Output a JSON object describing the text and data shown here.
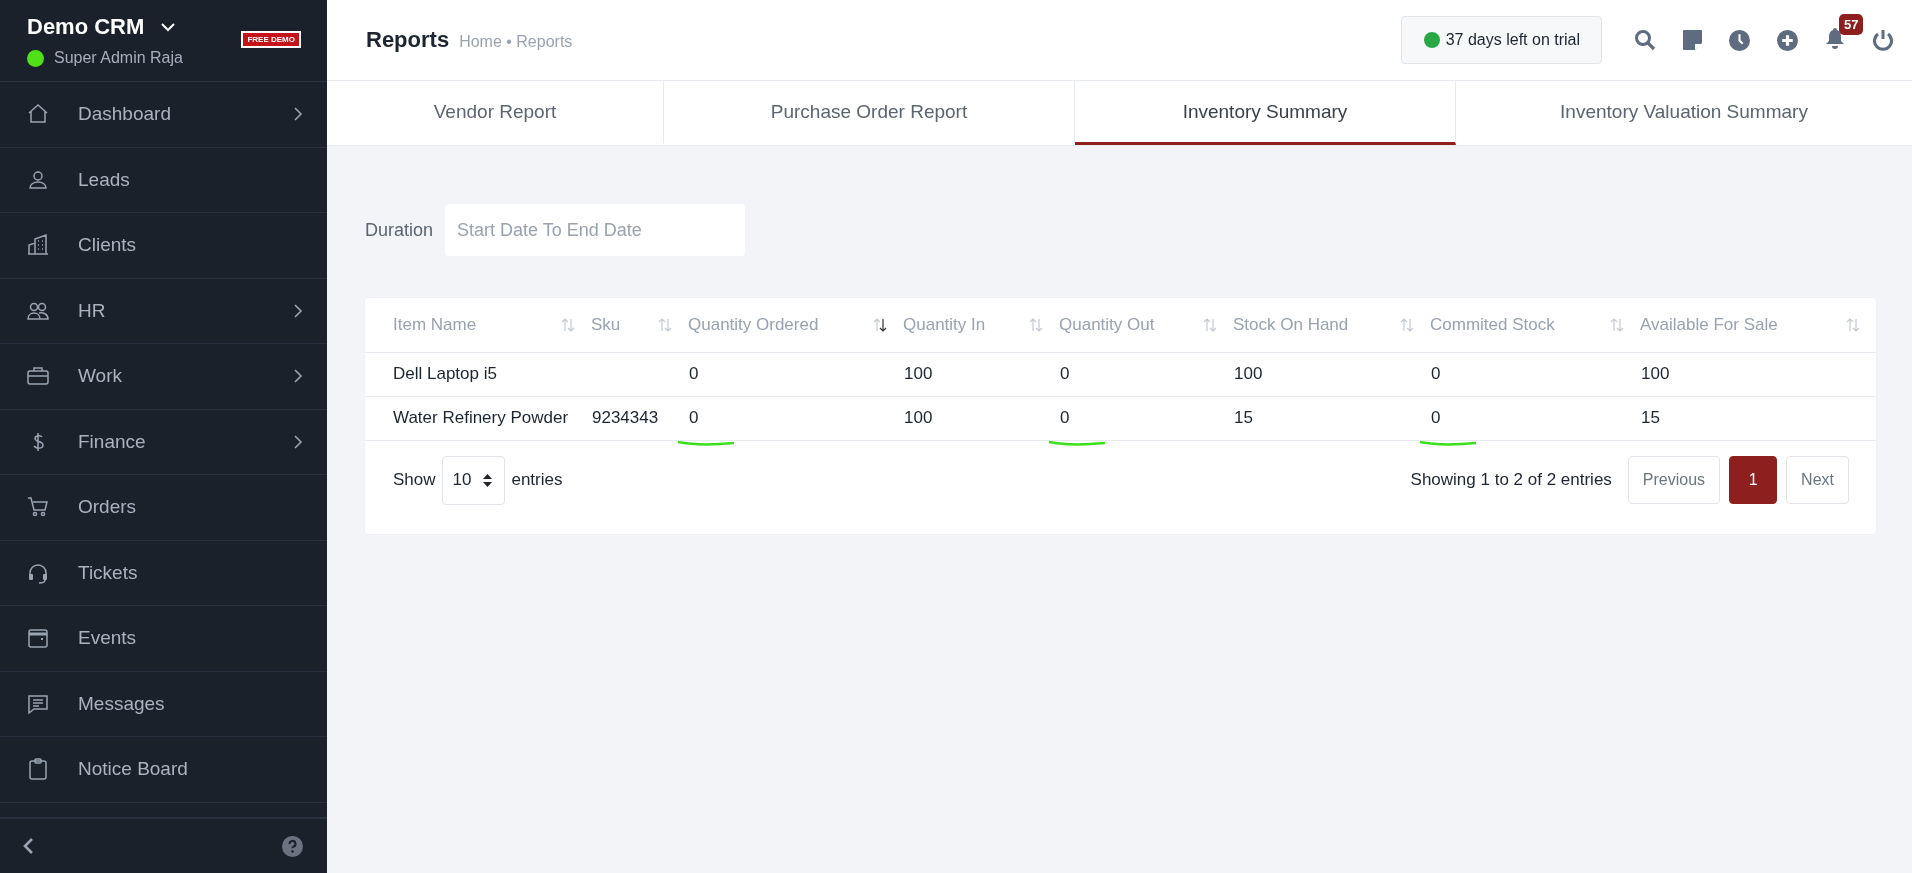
{
  "sidebar": {
    "app_name": "Demo CRM",
    "user": {
      "name": "Super Admin Raja",
      "online": true
    },
    "badge": "FREE DEMO",
    "items": [
      {
        "label": "Dashboard",
        "has_submenu": true
      },
      {
        "label": "Leads",
        "has_submenu": false
      },
      {
        "label": "Clients",
        "has_submenu": false
      },
      {
        "label": "HR",
        "has_submenu": true
      },
      {
        "label": "Work",
        "has_submenu": true
      },
      {
        "label": "Finance",
        "has_submenu": true
      },
      {
        "label": "Orders",
        "has_submenu": false
      },
      {
        "label": "Tickets",
        "has_submenu": false
      },
      {
        "label": "Events",
        "has_submenu": false
      },
      {
        "label": "Messages",
        "has_submenu": false
      },
      {
        "label": "Notice Board",
        "has_submenu": false
      }
    ]
  },
  "header": {
    "title": "Reports",
    "breadcrumb": "Home • Reports",
    "trial": "37 days left on trial",
    "notifications": "57"
  },
  "tabs": [
    {
      "label": "Vendor Report",
      "selected": false
    },
    {
      "label": "Purchase Order Report",
      "selected": false
    },
    {
      "label": "Inventory Summary",
      "selected": true
    },
    {
      "label": "Inventory Valuation Summary",
      "selected": false
    }
  ],
  "filter": {
    "label": "Duration",
    "placeholder": "Start Date To End Date"
  },
  "table": {
    "columns": [
      {
        "label": "Item Name",
        "sorted": false
      },
      {
        "label": "Sku",
        "sorted": false
      },
      {
        "label": "Quantity Ordered",
        "sorted": true
      },
      {
        "label": "Quantity In",
        "sorted": false
      },
      {
        "label": "Quantity Out",
        "sorted": false
      },
      {
        "label": "Stock On Hand",
        "sorted": false
      },
      {
        "label": "Commited Stock",
        "sorted": false
      },
      {
        "label": "Available For Sale",
        "sorted": false
      }
    ],
    "rows": [
      {
        "cells": [
          {
            "text": "Dell Laptop i5",
            "marked": false
          },
          {
            "text": "",
            "marked": false
          },
          {
            "text": "0",
            "marked": false
          },
          {
            "text": "100",
            "marked": false
          },
          {
            "text": "0",
            "marked": false
          },
          {
            "text": "100",
            "marked": false
          },
          {
            "text": "0",
            "marked": false
          },
          {
            "text": "100",
            "marked": false
          }
        ]
      },
      {
        "cells": [
          {
            "text": "Water Refinery Powder",
            "marked": false
          },
          {
            "text": "9234343",
            "marked": false
          },
          {
            "text": "0",
            "marked": true
          },
          {
            "text": "100",
            "marked": false
          },
          {
            "text": "0",
            "marked": true
          },
          {
            "text": "15",
            "marked": false
          },
          {
            "text": "0",
            "marked": true
          },
          {
            "text": "15",
            "marked": false
          }
        ]
      }
    ],
    "show_label": "Show",
    "page_size": "10",
    "entries_label": "entries",
    "info": "Showing 1 to 2 of 2 entries",
    "pagination": [
      {
        "label": "Previous",
        "kind": "nav",
        "selected": false
      },
      {
        "label": "1",
        "kind": "page",
        "selected": true
      },
      {
        "label": "Next",
        "kind": "nav",
        "selected": false
      }
    ]
  }
}
